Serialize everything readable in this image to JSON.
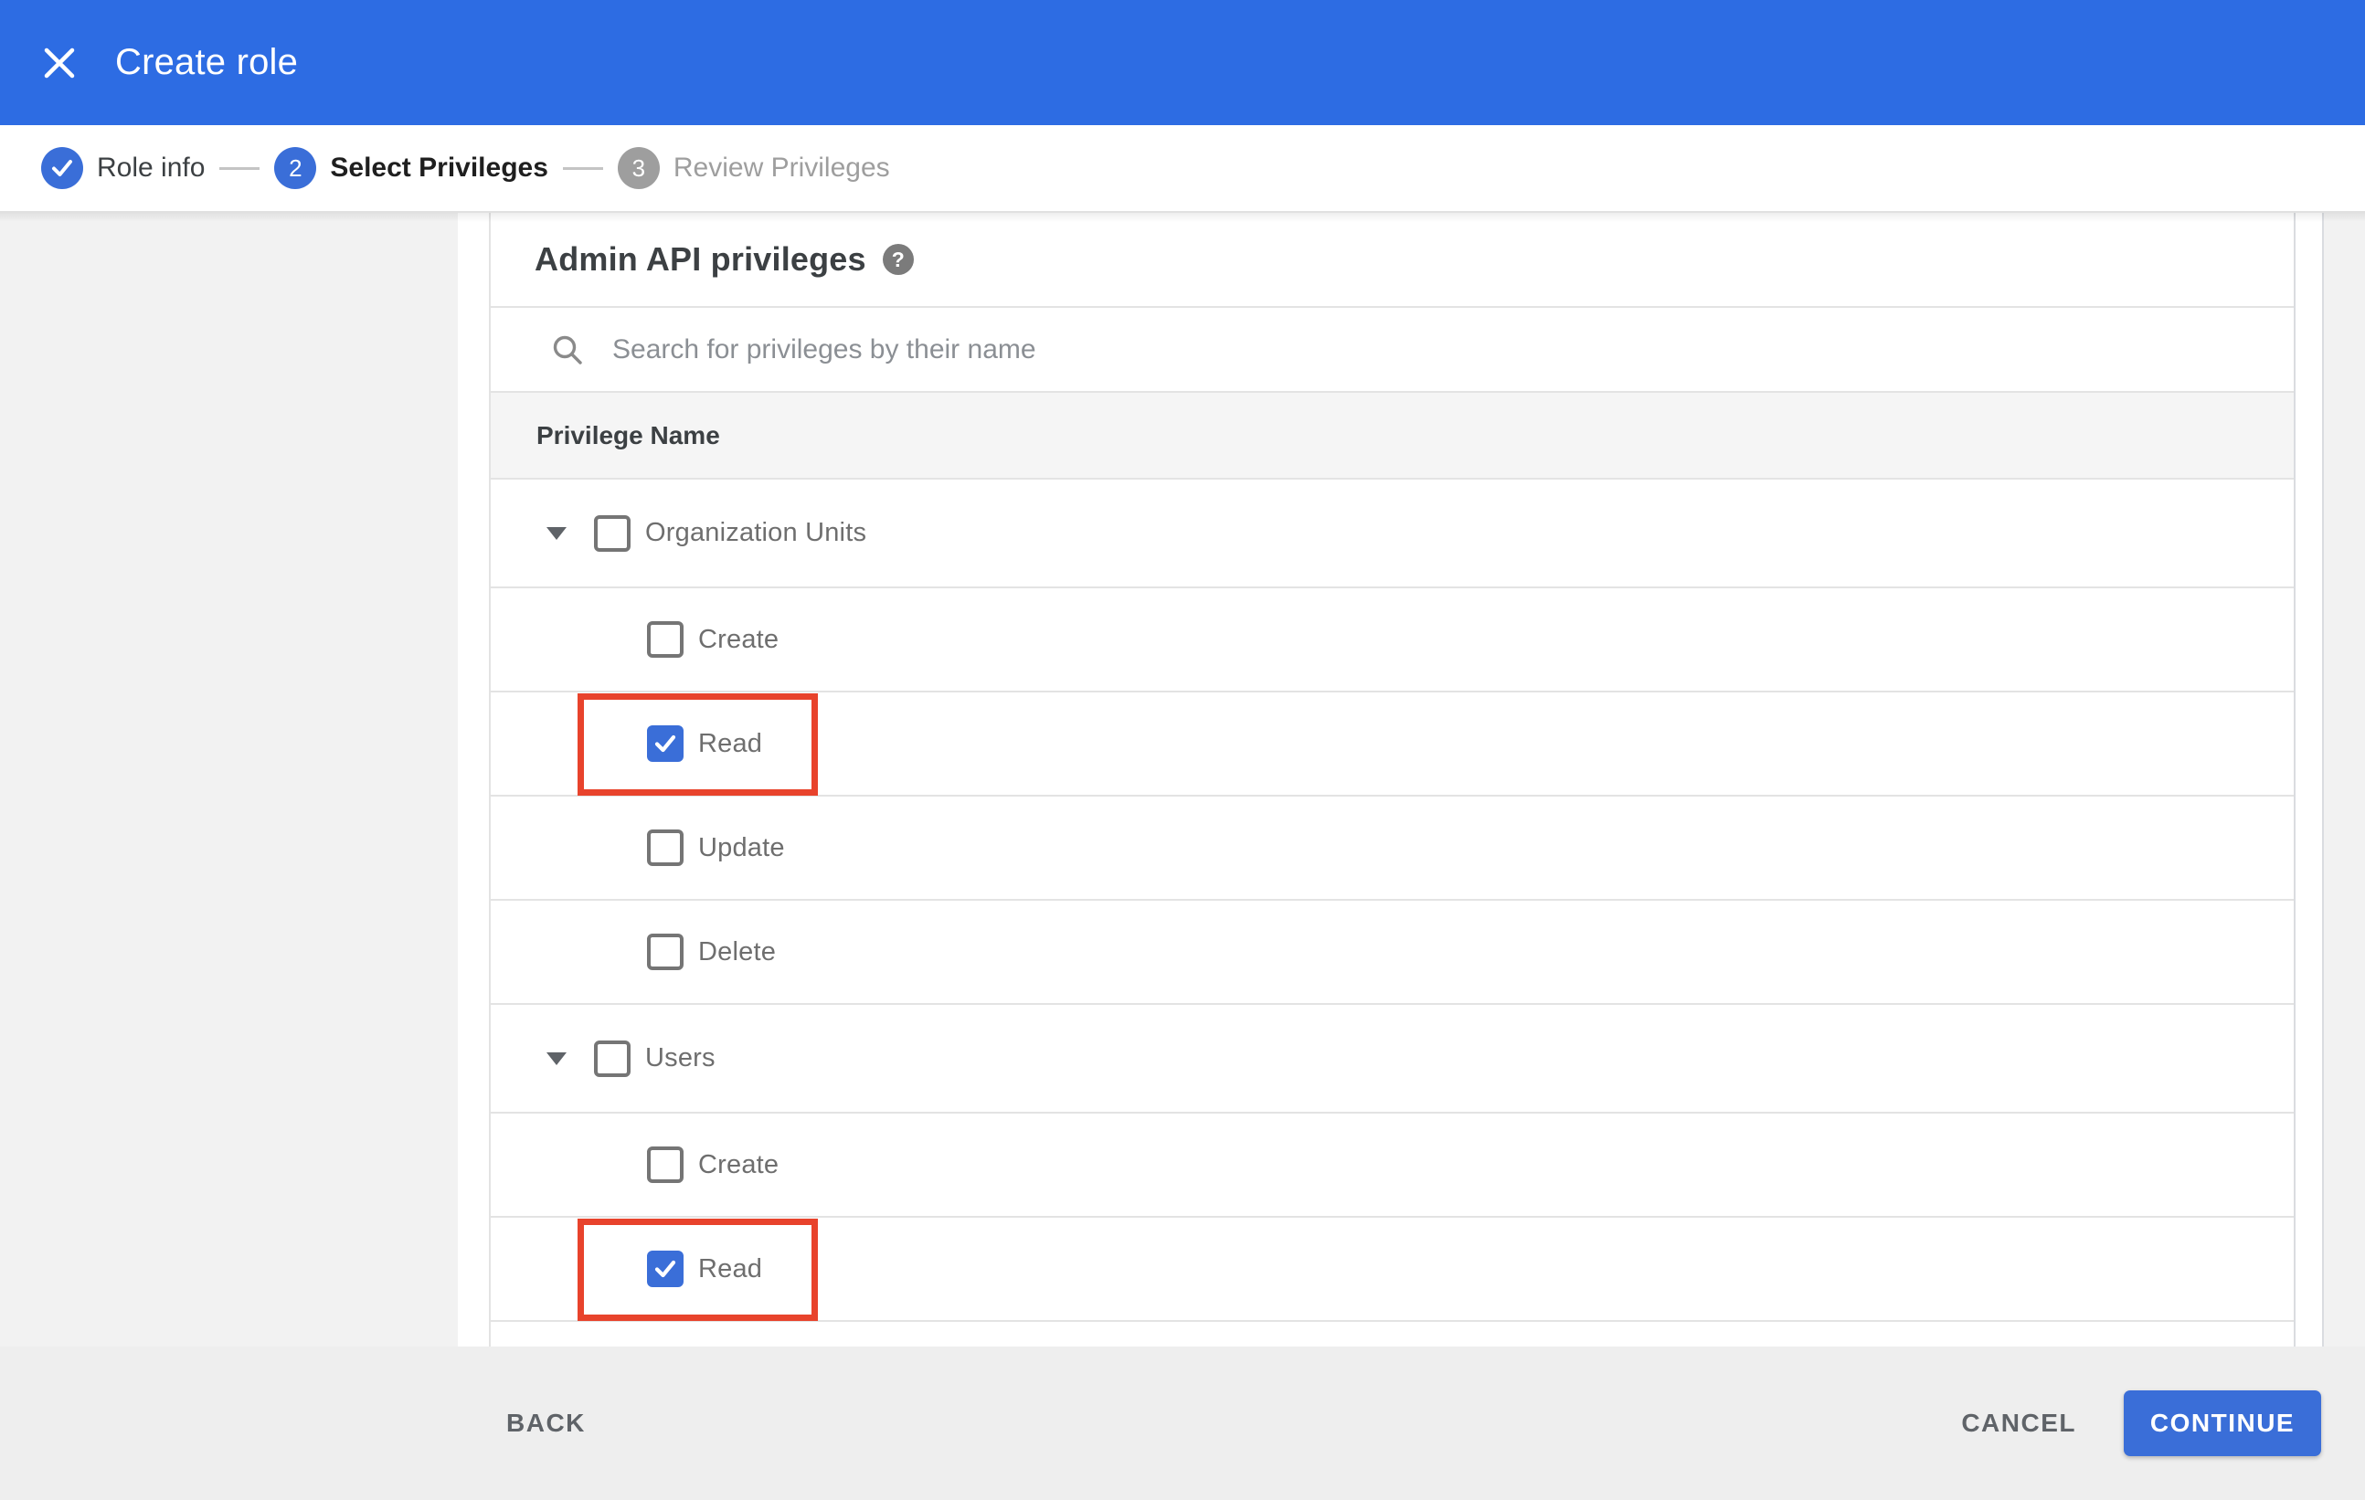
{
  "colors": {
    "header_blue": "#2d6ce3",
    "accent_blue": "#3a6ed8",
    "annotation_red": "#e8432c",
    "step_inactive_gray": "#9e9e9e"
  },
  "header": {
    "title": "Create role",
    "close_icon": "close-icon"
  },
  "stepper": {
    "steps": [
      {
        "number": "1",
        "label": "Role info",
        "state": "done",
        "icon": "check-icon"
      },
      {
        "number": "2",
        "label": "Select Privileges",
        "state": "current"
      },
      {
        "number": "3",
        "label": "Review Privileges",
        "state": "future"
      }
    ]
  },
  "content": {
    "heading": "Admin API privileges",
    "help_icon": "help-icon",
    "search_icon": "search-icon",
    "search_placeholder": "Search for privileges by their name",
    "search_value": "",
    "table": {
      "header_label": "Privilege Name",
      "rows": [
        {
          "type": "group",
          "label": "Organization Units",
          "checked": false,
          "annotated": false,
          "expanded": true
        },
        {
          "type": "child",
          "label": "Create",
          "checked": false,
          "annotated": false
        },
        {
          "type": "child",
          "label": "Read",
          "checked": true,
          "annotated": true
        },
        {
          "type": "child",
          "label": "Update",
          "checked": false,
          "annotated": false
        },
        {
          "type": "child",
          "label": "Delete",
          "checked": false,
          "annotated": false
        },
        {
          "type": "group",
          "label": "Users",
          "checked": false,
          "annotated": false,
          "expanded": true
        },
        {
          "type": "child",
          "label": "Create",
          "checked": false,
          "annotated": false
        },
        {
          "type": "child",
          "label": "Read",
          "checked": true,
          "annotated": true
        }
      ]
    }
  },
  "footer": {
    "back_label": "BACK",
    "cancel_label": "CANCEL",
    "continue_label": "CONTINUE"
  }
}
